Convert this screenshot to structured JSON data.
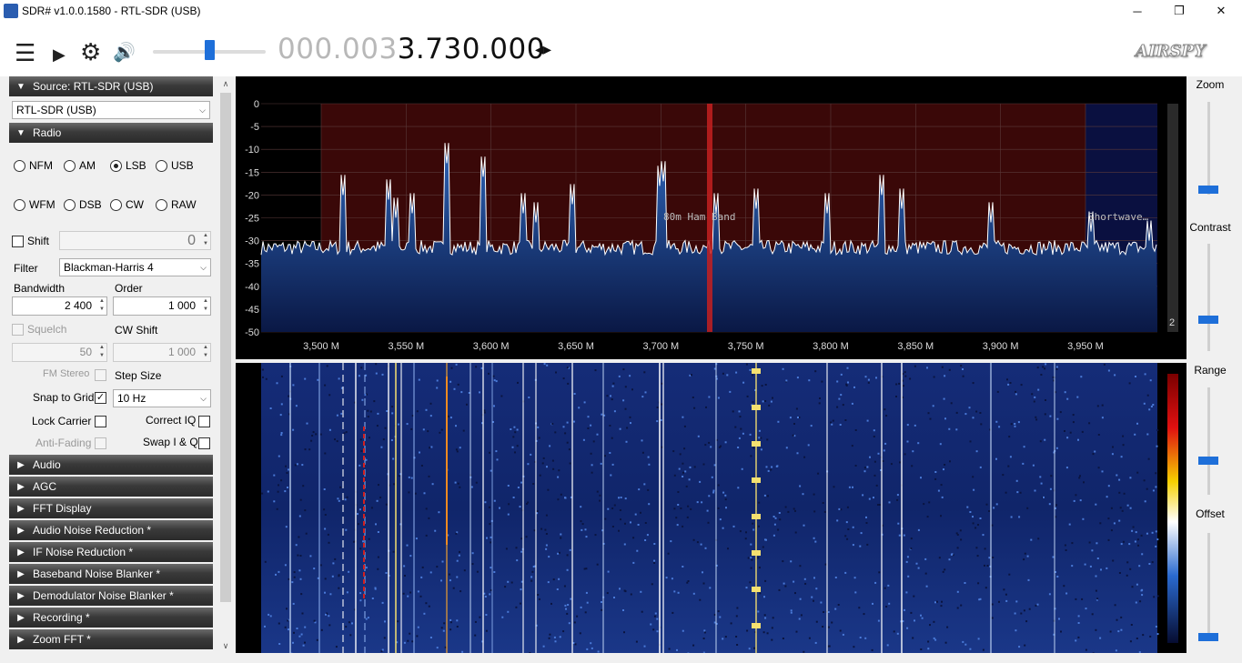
{
  "window": {
    "title": "SDR# v1.0.0.1580 - RTL-SDR (USB)",
    "minimize": "─",
    "restore": "❐",
    "close": "✕"
  },
  "toolbar": {
    "menu_icon": "☰",
    "play_icon": "▶",
    "settings_icon": "⚙",
    "volume_icon": "🔊",
    "volume_level": 0.5,
    "freq_dim": "000.003",
    "freq_bright": "3.730.000",
    "freq_arrows": "◂▸",
    "logo": "AIRSPY"
  },
  "source": {
    "header": "Source: RTL-SDR (USB)",
    "device": "RTL-SDR (USB)"
  },
  "radio": {
    "header": "Radio",
    "modes_row1": [
      {
        "label": "NFM",
        "selected": false
      },
      {
        "label": "AM",
        "selected": false
      },
      {
        "label": "LSB",
        "selected": true
      },
      {
        "label": "USB",
        "selected": false
      }
    ],
    "modes_row2": [
      {
        "label": "WFM",
        "selected": false
      },
      {
        "label": "DSB",
        "selected": false
      },
      {
        "label": "CW",
        "selected": false
      },
      {
        "label": "RAW",
        "selected": false
      }
    ],
    "shift_label": "Shift",
    "shift_value": "0",
    "filter_label": "Filter",
    "filter_value": "Blackman-Harris 4",
    "bandwidth_label": "Bandwidth",
    "bandwidth_value": "2 400",
    "order_label": "Order",
    "order_value": "1 000",
    "squelch_label": "Squelch",
    "squelch_value": "50",
    "cwshift_label": "CW Shift",
    "cwshift_value": "1 000",
    "fmstereo_label": "FM Stereo",
    "stepsize_label": "Step Size",
    "snap_label": "Snap to Grid",
    "step_value": "10 Hz",
    "lockcarrier_label": "Lock Carrier",
    "correctiq_label": "Correct IQ",
    "antifading_label": "Anti-Fading",
    "swapiq_label": "Swap I & Q"
  },
  "collapsed_sections": [
    "Audio",
    "AGC",
    "FFT Display",
    "Audio Noise Reduction *",
    "IF Noise Reduction *",
    "Baseband Noise Blanker *",
    "Demodulator Noise Blanker *",
    "Recording *",
    "Zoom FFT *"
  ],
  "spectrum": {
    "y_ticks": [
      "0",
      "-5",
      "-10",
      "-15",
      "-20",
      "-25",
      "-30",
      "-35",
      "-40",
      "-45",
      "-50"
    ],
    "x_ticks": [
      "3,500 M",
      "3,550 M",
      "3,600 M",
      "3,650 M",
      "3,700 M",
      "3,750 M",
      "3,800 M",
      "3,850 M",
      "3,900 M",
      "3,950 M"
    ],
    "band_label": "80m Ham Band",
    "shortwave_label": "Shortwave…",
    "corner_value": "2",
    "colors": {
      "band": "#3a0808",
      "shortwave": "#0a1040",
      "signal": "#2c5aa8",
      "tuned": "#c42020"
    }
  },
  "right_controls": {
    "zoom_label": "Zoom",
    "contrast_label": "Contrast",
    "range_label": "Range",
    "offset_label": "Offset"
  }
}
